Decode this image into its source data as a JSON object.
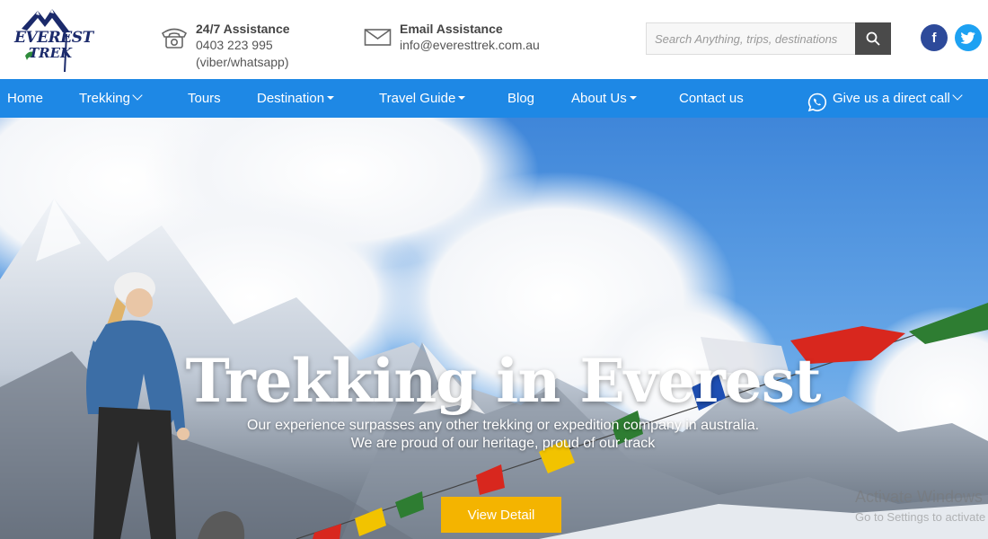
{
  "logo": {
    "line1": "EVEREST",
    "line2": "TREK"
  },
  "contact_phone": {
    "icon": "phone-icon",
    "title": "24/7 Assistance",
    "number": "0403 223 995",
    "note": "(viber/whatsapp)"
  },
  "contact_email": {
    "icon": "envelope-icon",
    "title": "Email Assistance",
    "address": "info@everesttrek.com.au"
  },
  "search": {
    "placeholder": "Search Anything, trips, destinations",
    "icon": "search-icon"
  },
  "social": {
    "facebook": "f",
    "twitter_icon": "twitter-icon"
  },
  "nav": {
    "items": [
      {
        "label": "Home"
      },
      {
        "label": "Trekking"
      },
      {
        "label": "Tours"
      },
      {
        "label": "Destination"
      },
      {
        "label": "Travel Guide"
      },
      {
        "label": "Blog"
      },
      {
        "label": "About Us"
      },
      {
        "label": "Contact us"
      }
    ],
    "direct_call": "Give us a direct call"
  },
  "hero": {
    "title": "Trekking in Everest",
    "subtitle": "Our experience surpasses any other trekking or expedition company in australia. We are proud of our heritage, proud of our track",
    "button": "View Detail"
  },
  "watermark": {
    "line1": "Activate Windows",
    "line2": "Go to Settings to activate Windows."
  },
  "colors": {
    "nav": "#1e88e5",
    "button": "#f4b400",
    "facebook": "#2d4a9a",
    "twitter": "#1da1f2"
  }
}
